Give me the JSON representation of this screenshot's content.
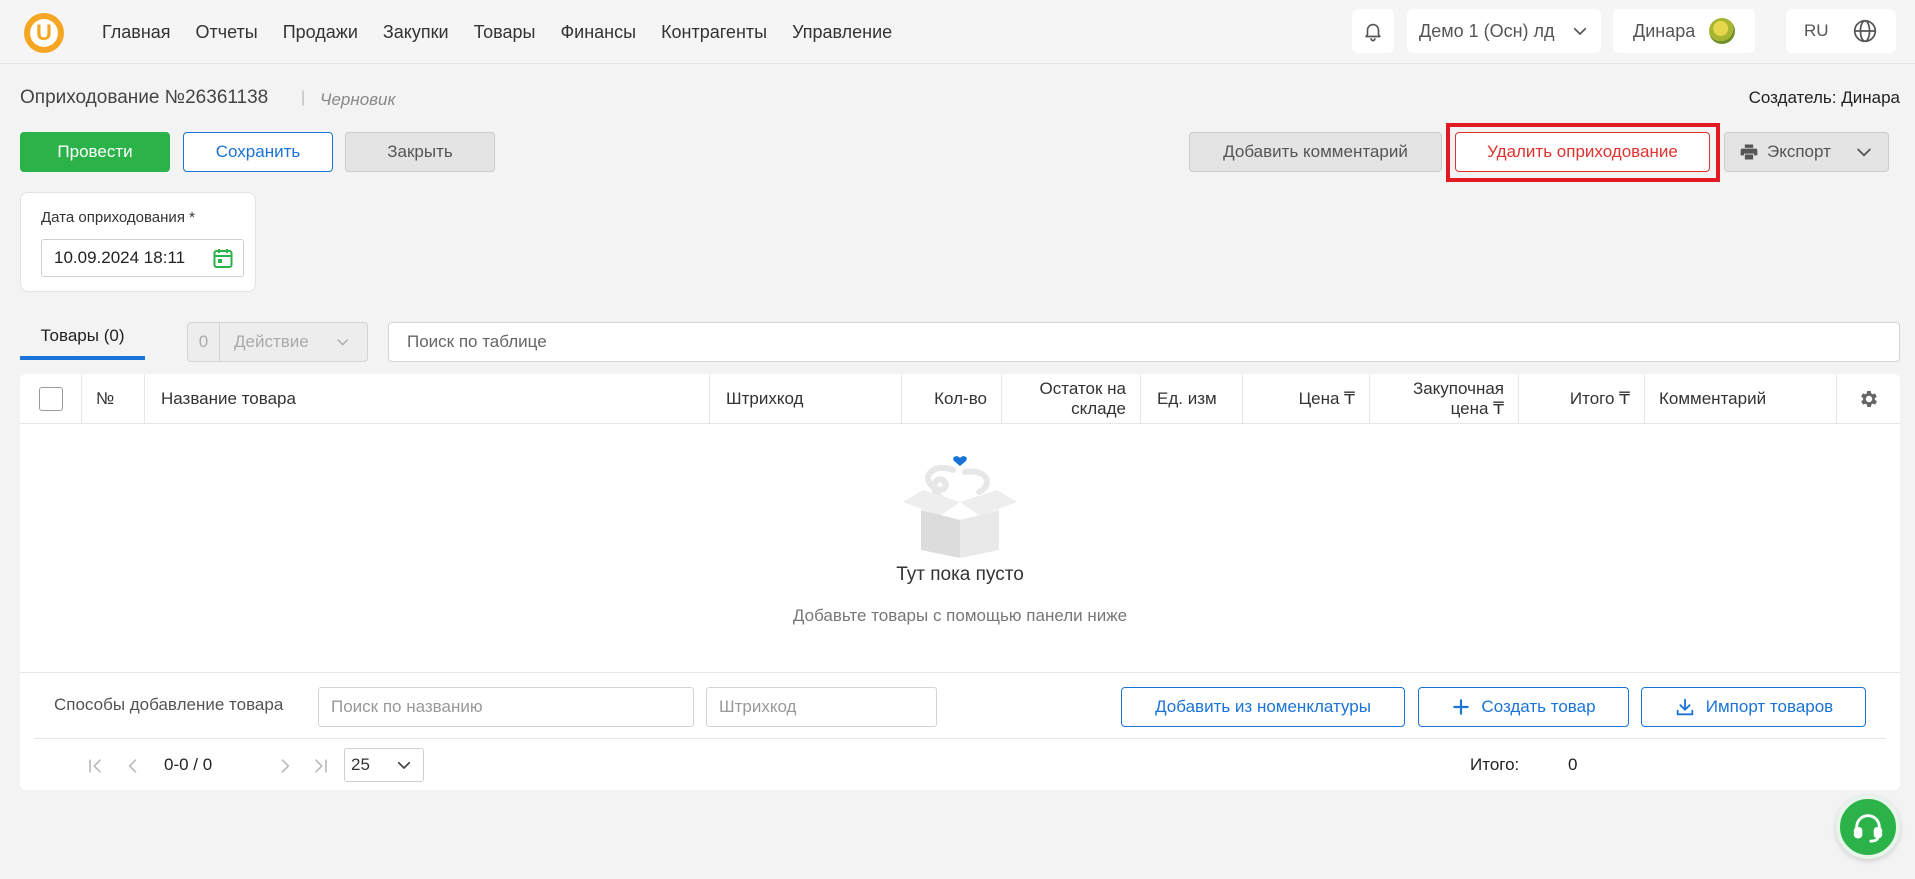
{
  "nav": {
    "logo_letter": "U",
    "items": [
      "Главная",
      "Отчеты",
      "Продажи",
      "Закупки",
      "Товары",
      "Финансы",
      "Контрагенты",
      "Управление"
    ],
    "org": "Демо 1 (Осн) лд",
    "user": "Динара",
    "lang": "RU"
  },
  "doc": {
    "title": "Оприходование №26361138",
    "separator": "|",
    "status": "Черновик",
    "creator": "Создатель: Динара"
  },
  "actions": {
    "post": "Провести",
    "save": "Сохранить",
    "close": "Закрыть",
    "comment": "Добавить комментарий",
    "delete": "Удалить оприходование",
    "export": "Экспорт"
  },
  "date_field": {
    "label": "Дата оприходования *",
    "value": "10.09.2024 18:11"
  },
  "tabs": {
    "products": "Товары  (0)"
  },
  "bulk": {
    "count": "0",
    "label": "Действие"
  },
  "table_search": {
    "placeholder": "Поиск по таблице"
  },
  "table": {
    "columns": {
      "num": "№",
      "name": "Название товара",
      "barcode": "Штрихкод",
      "qty": "Кол-во",
      "stock_1": "Остаток на",
      "stock_2": "складе",
      "unit": "Ед. изм",
      "price": "Цена ₸",
      "purchase_1": "Закупочная",
      "purchase_2": "цена ₸",
      "total": "Итого ₸",
      "comment": "Комментарий"
    },
    "empty_title": "Тут пока пусто",
    "empty_subtitle": "Добавьте товары с помощью панели ниже"
  },
  "add_panel": {
    "label": "Способы добавление товара",
    "name_placeholder": "Поиск по названию",
    "barcode_placeholder": "Штрихкод",
    "from_catalog": "Добавить из номенклатуры",
    "create": "Создать товар",
    "import": "Импорт товаров"
  },
  "pagination": {
    "range": "0-0 / 0",
    "page_size": "25",
    "total_label": "Итого:",
    "total_value": "0"
  },
  "colors": {
    "primary": "#1a73d6",
    "success": "#2bb34a",
    "danger": "#e0322f",
    "highlight": "#e01b24",
    "logo": "#f6a623"
  }
}
